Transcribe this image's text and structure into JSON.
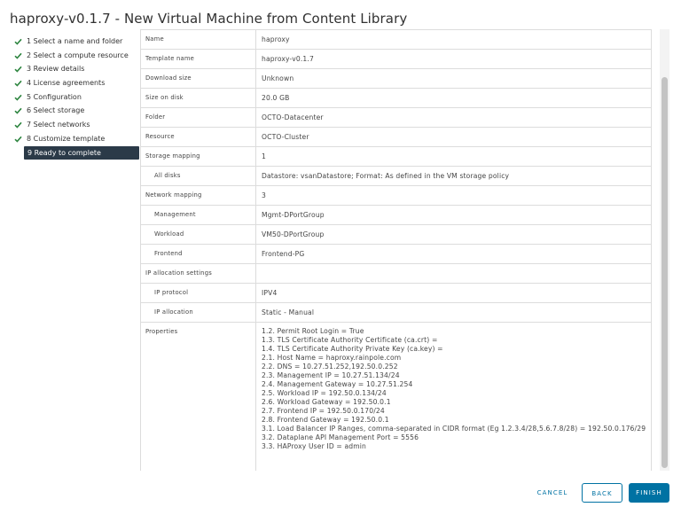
{
  "window": {
    "title": "haproxy-v0.1.7 - New Virtual Machine from Content Library"
  },
  "steps": [
    {
      "label": "1 Select a name and folder",
      "done": true
    },
    {
      "label": "2 Select a compute resource",
      "done": true
    },
    {
      "label": "3 Review details",
      "done": true
    },
    {
      "label": "4 License agreements",
      "done": true
    },
    {
      "label": "5 Configuration",
      "done": true
    },
    {
      "label": "6 Select storage",
      "done": true
    },
    {
      "label": "7 Select networks",
      "done": true
    },
    {
      "label": "8 Customize template",
      "done": true
    },
    {
      "label": "9 Ready to complete",
      "done": false,
      "active": true
    }
  ],
  "review": {
    "rows": [
      {
        "key": "Name",
        "value": "haproxy"
      },
      {
        "key": "Template name",
        "value": "haproxy-v0.1.7"
      },
      {
        "key": "Download size",
        "value": "Unknown"
      },
      {
        "key": "Size on disk",
        "value": "20.0 GB"
      },
      {
        "key": "Folder",
        "value": "OCTO-Datacenter"
      },
      {
        "key": "Resource",
        "value": "OCTO-Cluster"
      },
      {
        "key": "Storage mapping",
        "value": "1"
      },
      {
        "key": "All disks",
        "value": "Datastore: vsanDatastore; Format: As defined in the VM storage policy"
      },
      {
        "key": "Network mapping",
        "value": "3"
      },
      {
        "key": "Management",
        "value": "Mgmt-DPortGroup"
      },
      {
        "key": "Workload",
        "value": "VM50-DPortGroup"
      },
      {
        "key": "Frontend",
        "value": "Frontend-PG"
      },
      {
        "key": "IP allocation settings",
        "value": ""
      },
      {
        "key": "IP protocol",
        "value": "IPV4"
      },
      {
        "key": "IP allocation",
        "value": "Static - Manual"
      }
    ],
    "properties_label": "Properties",
    "properties": [
      "1.2. Permit Root Login = True",
      "1.3. TLS Certificate Authority Certificate (ca.crt) =",
      "1.4. TLS Certificate Authority Private Key (ca.key) =",
      "2.1. Host Name = haproxy.rainpole.com",
      "2.2. DNS = 10.27.51.252,192.50.0.252",
      "2.3. Management IP = 10.27.51.134/24",
      "2.4. Management Gateway = 10.27.51.254",
      "2.5. Workload IP = 192.50.0.134/24",
      "2.6. Workload Gateway = 192.50.0.1",
      "2.7. Frontend IP = 192.50.0.170/24",
      "2.8. Frontend Gateway = 192.50.0.1",
      "3.1. Load Balancer IP Ranges, comma-separated in CIDR format (Eg 1.2.3.4/28,5.6.7.8/28) = 192.50.0.176/29",
      "3.2. Dataplane API Management Port = 5556",
      "3.3. HAProxy User ID = admin"
    ]
  },
  "footer": {
    "cancel_label": "CANCEL",
    "back_label": "BACK",
    "finish_label": "FINISH"
  },
  "colors": {
    "accent": "#0072a3",
    "check": "#2e8540",
    "active_step_bg": "#2b3a48"
  }
}
